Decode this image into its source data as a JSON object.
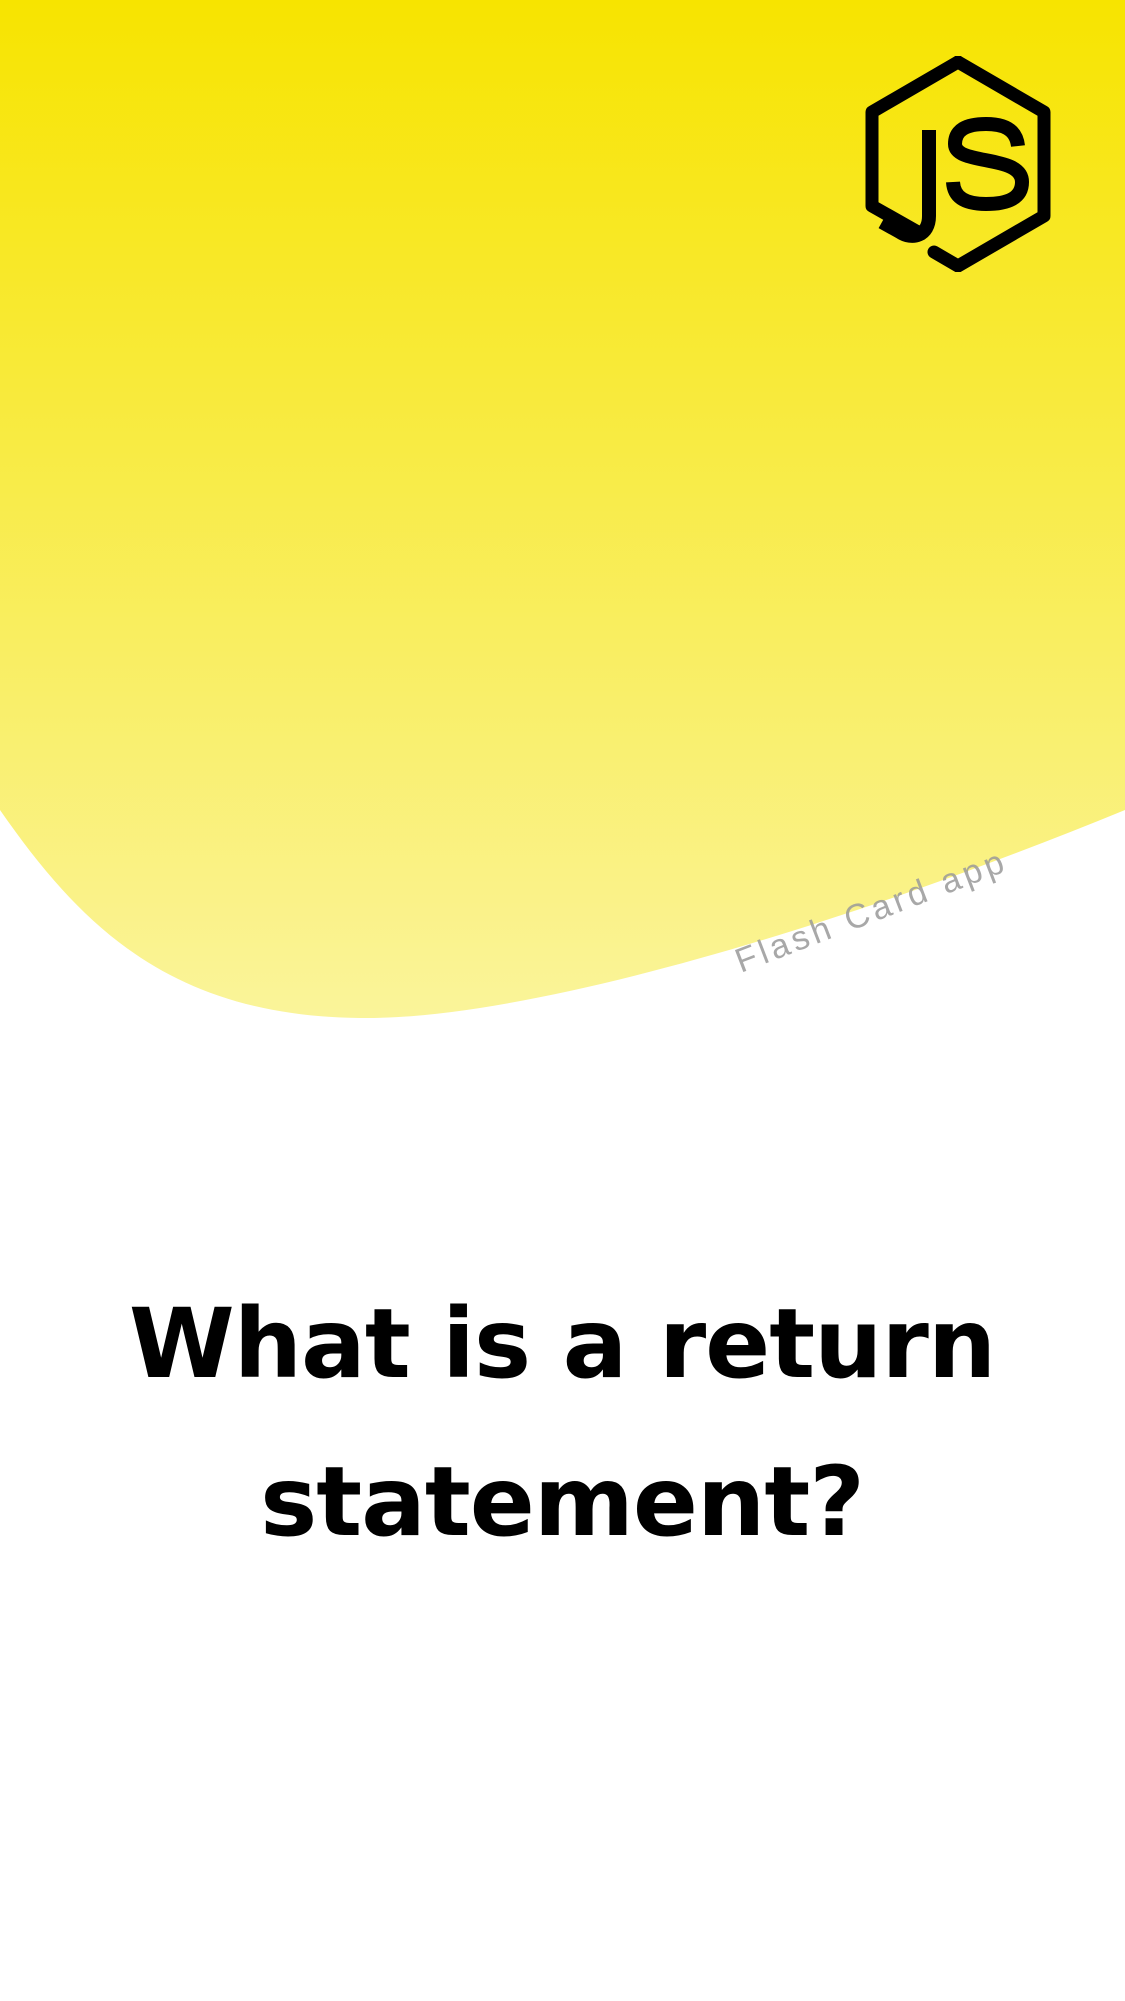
{
  "app": {
    "subtitle": "Flash Card app",
    "logo_icon": "nodejs-hexagon-js-icon"
  },
  "card": {
    "question": "What is a return statement?"
  },
  "colors": {
    "header_top": "#F7E400",
    "header_bottom": "#FAF290",
    "text": "#000000",
    "subtitle": "#9A9A9A",
    "background": "#FFFFFF"
  }
}
